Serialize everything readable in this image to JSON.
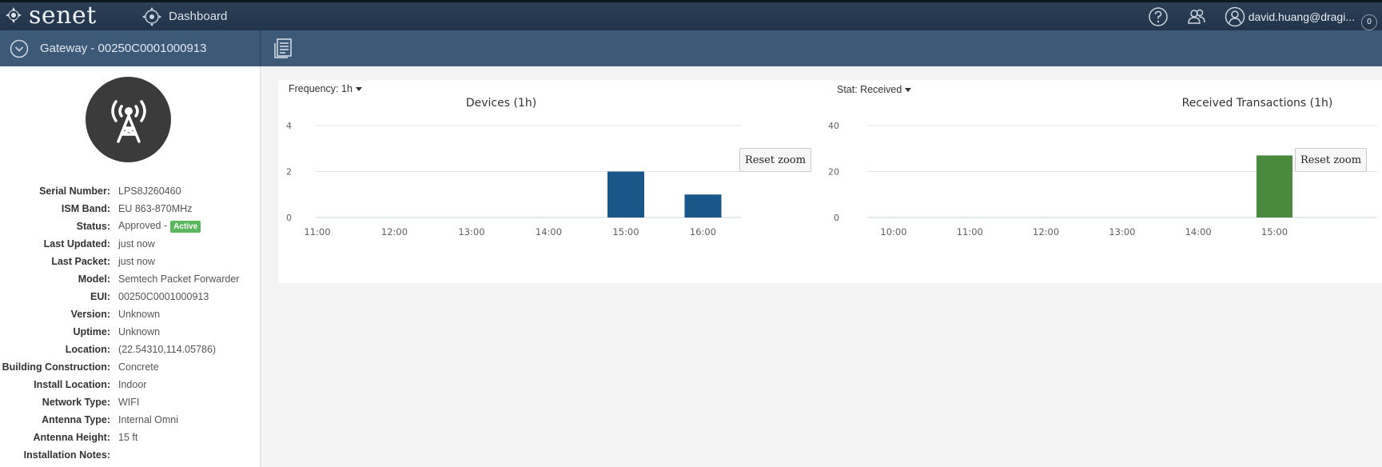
{
  "app": {
    "logo_text": "senet",
    "nav_dashboard": "Dashboard",
    "user_email": "david.huang@dragi...",
    "notif_count": "0"
  },
  "subheader": {
    "title": "Gateway - 00250C0001000913"
  },
  "gateway": {
    "details": [
      {
        "label": "Serial Number:",
        "value": "LPS8J260460"
      },
      {
        "label": "ISM Band:",
        "value": "EU 863-870MHz"
      },
      {
        "label": "Status:",
        "value": "Approved -",
        "badge": "Active"
      },
      {
        "label": "Last Updated:",
        "value": "just now"
      },
      {
        "label": "Last Packet:",
        "value": "just now"
      },
      {
        "label": "Model:",
        "value": "Semtech Packet Forwarder"
      },
      {
        "label": "EUI:",
        "value": "00250C0001000913"
      },
      {
        "label": "Version:",
        "value": "Unknown"
      },
      {
        "label": "Uptime:",
        "value": "Unknown"
      },
      {
        "label": "Location:",
        "value": "(22.54310,114.05786)"
      },
      {
        "label": "Building Construction:",
        "value": "Concrete"
      },
      {
        "label": "Install Location:",
        "value": "Indoor"
      },
      {
        "label": "Network Type:",
        "value": "WIFI"
      },
      {
        "label": "Antenna Type:",
        "value": "Internal Omni"
      },
      {
        "label": "Antenna Height:",
        "value": "15 ft"
      },
      {
        "label": "Installation Notes:",
        "value": ""
      }
    ]
  },
  "controls": {
    "frequency_label": "Frequency: 1h",
    "stat_label": "Stat: Received",
    "reset_zoom": "Reset zoom"
  },
  "colors": {
    "devices_bar": "#1a5788",
    "transactions_bar": "#4a8a3f"
  },
  "chart_data": [
    {
      "type": "bar",
      "title": "Devices (1h)",
      "categories": [
        "11:00",
        "12:00",
        "13:00",
        "14:00",
        "15:00",
        "16:00"
      ],
      "values": [
        0,
        0,
        0,
        0,
        2,
        1
      ],
      "yticks": [
        0,
        2,
        4
      ],
      "ylim": [
        0,
        4
      ],
      "grid": true
    },
    {
      "type": "bar",
      "title": "Received Transactions (1h)",
      "categories": [
        "10:00",
        "11:00",
        "12:00",
        "13:00",
        "14:00",
        "15:00"
      ],
      "values": [
        0,
        0,
        0,
        0,
        0,
        27
      ],
      "yticks": [
        0,
        20,
        40
      ],
      "ylim": [
        0,
        40
      ],
      "grid": true
    }
  ]
}
